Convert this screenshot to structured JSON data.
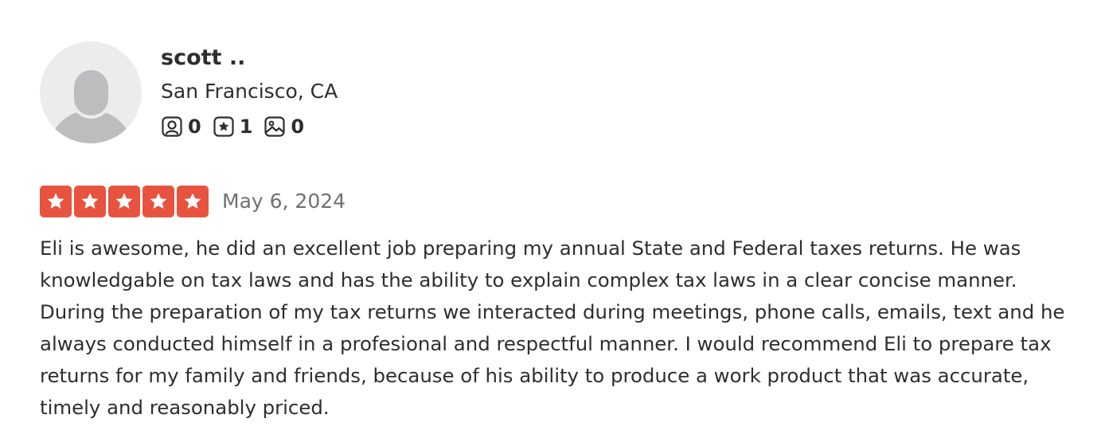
{
  "review": {
    "user": {
      "name": "scott ..",
      "location": "San Francisco, CA",
      "avatar_icon": "default-user-avatar",
      "stats": [
        {
          "icon": "friends-icon",
          "count": "0"
        },
        {
          "icon": "reviews-icon",
          "count": "1"
        },
        {
          "icon": "photos-icon",
          "count": "0"
        }
      ]
    },
    "rating": 5,
    "rating_max": 5,
    "star_color": "#e7533f",
    "date": "May 6, 2024",
    "text": "Eli is awesome, he did an excellent job preparing my annual State and Federal taxes returns. He was knowledgable on tax laws and has the ability to explain complex tax laws in a clear concise manner. During the preparation of my tax returns we interacted during meetings, phone calls, emails, text and he always conducted himself in a profesional and respectful manner. I would recommend Eli to prepare tax returns for my family and friends, because of his ability to produce a work product that was accurate, timely and reasonably priced."
  }
}
